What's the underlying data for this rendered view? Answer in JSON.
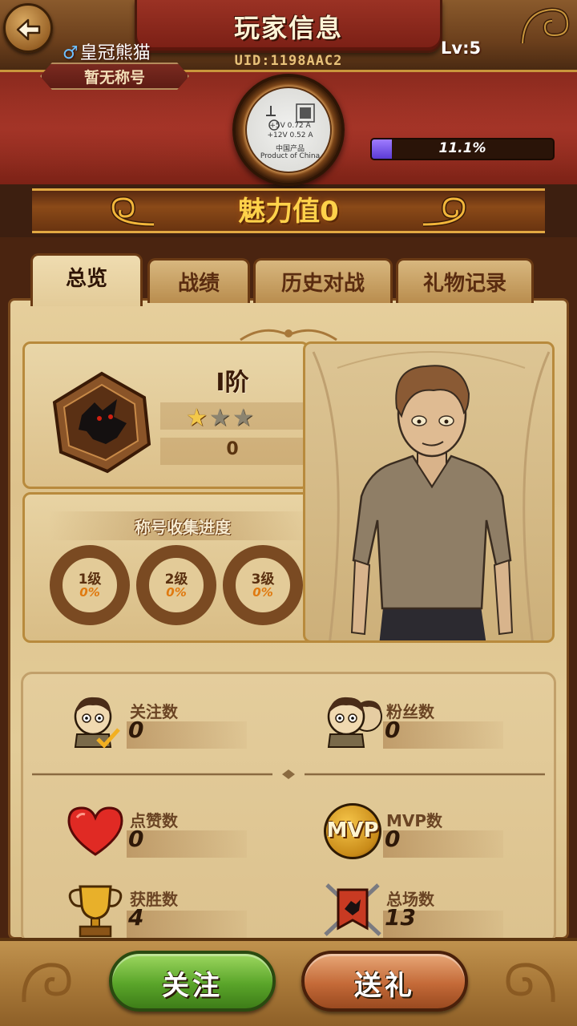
{
  "header": {
    "title": "玩家信息",
    "uid": "UID:1198AAC2"
  },
  "profile": {
    "gender_symbol": "♂",
    "name": "皇冠熊猫",
    "title_badge": "暂无称号",
    "level": "Lv:5",
    "exp_percent_text": "11.1%",
    "exp_fraction": 0.111,
    "avatar_lines": [
      "+5V 0.72 A",
      "+12V 0.52 A",
      "中国产品",
      "Product of China"
    ]
  },
  "charm": {
    "label": "魅力值",
    "value": "0"
  },
  "tabs": [
    {
      "label": "总览",
      "active": true
    },
    {
      "label": "战绩",
      "active": false
    },
    {
      "label": "历史对战",
      "active": false
    },
    {
      "label": "礼物记录",
      "active": false
    }
  ],
  "rank": {
    "name": "I阶",
    "stars_filled": 1,
    "stars_total": 3,
    "points": "0"
  },
  "collection": {
    "title": "称号收集进度",
    "rings": [
      {
        "level": "1级",
        "percent": "0%"
      },
      {
        "level": "2级",
        "percent": "0%"
      },
      {
        "level": "3级",
        "percent": "0%"
      }
    ]
  },
  "stats": {
    "follows": {
      "label": "关注数",
      "value": "0"
    },
    "fans": {
      "label": "粉丝数",
      "value": "0"
    },
    "likes": {
      "label": "点赞数",
      "value": "0"
    },
    "mvp": {
      "label": "MVP数",
      "value": "0",
      "badge": "MVP"
    },
    "wins": {
      "label": "获胜数",
      "value": "4"
    },
    "total": {
      "label": "总场数",
      "value": "13"
    }
  },
  "actions": {
    "follow_label": "关注",
    "gift_label": "送礼"
  },
  "colors": {
    "accent_gold": "#e2a842",
    "parchment": "#e3cc98",
    "follow_green": "#5aa52a",
    "gift_orange": "#c46a38",
    "exp_purple": "#7b5cf0"
  }
}
